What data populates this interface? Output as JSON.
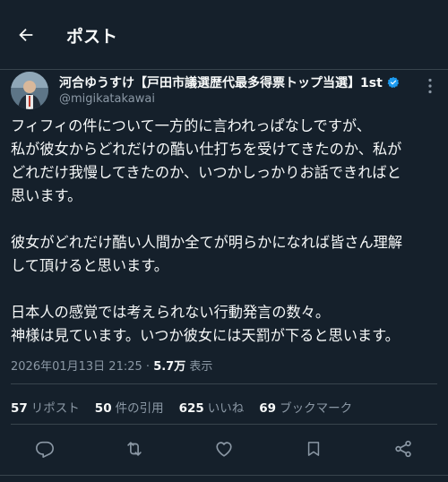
{
  "header": {
    "title": "ポスト"
  },
  "author": {
    "name": "河合ゆうすけ【戸田市議選歴代最多得票トップ当選】1st",
    "handle": "@migikatakawai",
    "verified_color": "#1d9bf0"
  },
  "tweet": {
    "paragraphs": [
      [
        "フィフィの件について一方的に言われっぱなしですが、",
        "私が彼女からどれだけの酷い仕打ちを受けてきたのか、私が",
        "どれだけ我慢してきたのか、いつかしっかりお話できればと",
        "思います。"
      ],
      [
        "彼女がどれだけ酷い人間か全てが明らかになれば皆さん理解",
        "して頂けると思います。"
      ],
      [
        "日本人の感覚では考えられない行動発言の数々。",
        "神様は見ています。いつか彼女には天罰が下ると思います。"
      ]
    ],
    "timestamp": "2026年01月13日 21:25",
    "separator": "·",
    "views": "5.7万",
    "views_label": "表示"
  },
  "stats": [
    {
      "num": "57",
      "label": "リポスト"
    },
    {
      "num": "50",
      "label": "件の引用"
    },
    {
      "num": "625",
      "label": "いいね"
    },
    {
      "num": "69",
      "label": "ブックマーク"
    }
  ],
  "icons": {
    "back": "arrow-left-icon",
    "more": "more-vertical-icon",
    "reply": "reply-icon",
    "repost": "repost-icon",
    "like": "heart-icon",
    "bookmark": "bookmark-icon",
    "share": "share-icon"
  }
}
